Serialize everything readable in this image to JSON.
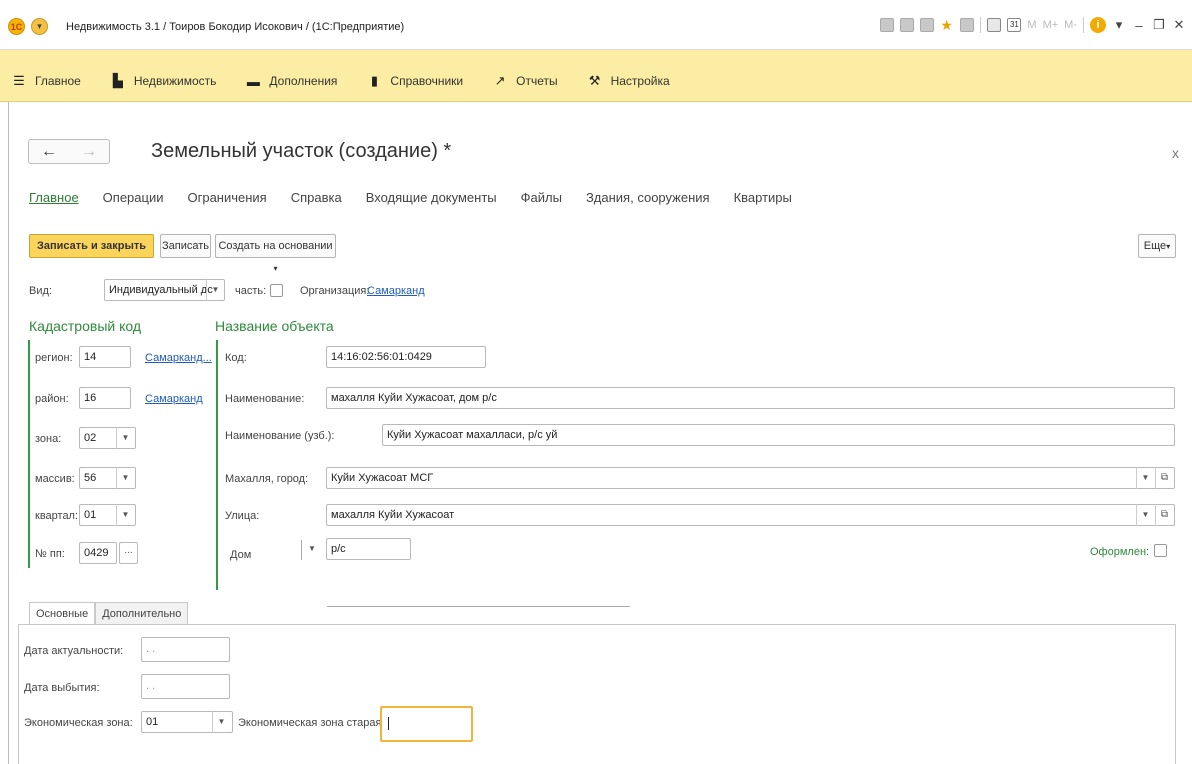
{
  "window": {
    "title": "Недвижимость 3.1 / Тоиров Бокодир Исокович / (1С:Предприятие)",
    "logo_text": "1С",
    "toolbar_memory": [
      "M",
      "M+",
      "M-"
    ],
    "toolbar_calendar": "31"
  },
  "sections": [
    {
      "icon": "hamburger-icon",
      "label": "Главное"
    },
    {
      "icon": "building-icon",
      "label": "Недвижимость"
    },
    {
      "icon": "list-icon",
      "label": "Дополнения"
    },
    {
      "icon": "book-icon",
      "label": "Справочники"
    },
    {
      "icon": "chart-icon",
      "label": "Отчеты"
    },
    {
      "icon": "wrench-icon",
      "label": "Настройка"
    }
  ],
  "form": {
    "title": "Земельный участок (создание) *",
    "tabs": [
      "Главное",
      "Операции",
      "Ограничения",
      "Справка",
      "Входящие документы",
      "Файлы",
      "Здания, сооружения",
      "Квартиры"
    ],
    "buttons": {
      "save_close": "Записать и закрыть",
      "save": "Записать",
      "create_based": "Создать на основании",
      "more": "Еще"
    },
    "vid": {
      "label": "Вид:",
      "value": "Индивидуальный дс"
    },
    "part_label": "часть:",
    "organization": {
      "label": "Организация:",
      "value": "Самарканд"
    },
    "cadastral": {
      "title": "Кадастровый код",
      "region": {
        "label": "регион:",
        "value": "14",
        "link": "Самарканд..."
      },
      "district": {
        "label": "район:",
        "value": "16",
        "link": "Самарканд"
      },
      "zone": {
        "label": "зона:",
        "value": "02"
      },
      "massif": {
        "label": "массив:",
        "value": "56"
      },
      "quarter": {
        "label": "квартал:",
        "value": "01"
      },
      "number": {
        "label": "№ пп:",
        "value": "0429",
        "button": "..."
      }
    },
    "object": {
      "title": "Название объекта",
      "code": {
        "label": "Код:",
        "value": "14:16:02:56:01:0429"
      },
      "name": {
        "label": "Наименование:",
        "value": "махалля Куйи Хужасоат, дом р/с"
      },
      "name_uz": {
        "label": "Наименование (узб.):",
        "value": "Куйи Хужасоат махалласи, р/с уй"
      },
      "mahalla": {
        "label": "Махалля, город:",
        "value": "Куйи Хужасоат МСГ"
      },
      "street": {
        "label": "Улица:",
        "value": "махалля Куйи Хужасоат"
      },
      "house": {
        "label": "Дом",
        "value": "р/с"
      },
      "registered_label": "Оформлен:"
    },
    "bottom_tabs": [
      "Основные",
      "Дополнительно"
    ],
    "main_tab": {
      "actual_date": {
        "label": "Дата актуальности:",
        "value": ". ."
      },
      "retire_date": {
        "label": "Дата выбытия:",
        "value": ". ."
      },
      "econ_zone": {
        "label": "Экономическая зона:",
        "value": "01"
      },
      "econ_zone_old": {
        "label": "Экономическая зона старая:",
        "value": ""
      }
    }
  }
}
